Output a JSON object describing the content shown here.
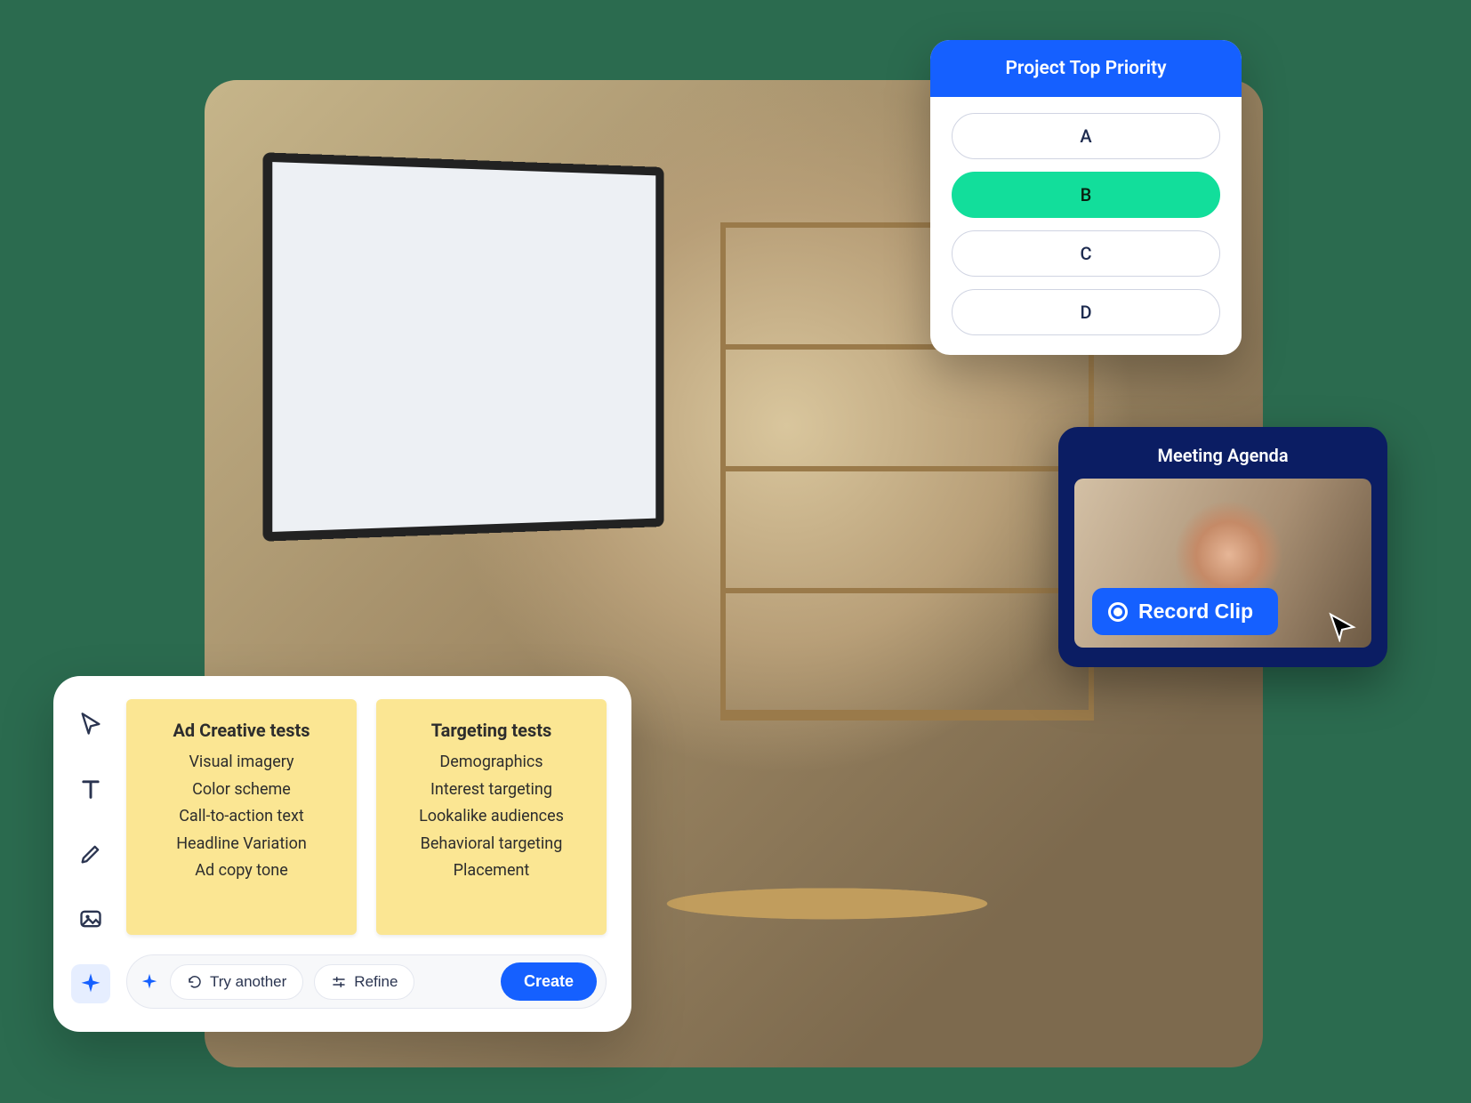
{
  "poll": {
    "title": "Project Top Priority",
    "options": [
      "A",
      "B",
      "C",
      "D"
    ],
    "selected_index": 1
  },
  "agenda": {
    "title": "Meeting Agenda",
    "record_label": "Record Clip"
  },
  "ai_panel": {
    "notes": [
      {
        "title": "Ad Creative tests",
        "items": [
          "Visual imagery",
          "Color scheme",
          "Call-to-action text",
          "Headline Variation",
          "Ad copy tone"
        ]
      },
      {
        "title": "Targeting tests",
        "items": [
          "Demographics",
          "Interest targeting",
          "Lookalike audiences",
          "Behavioral targeting",
          "Placement"
        ]
      }
    ],
    "actions": {
      "try_another": "Try another",
      "refine": "Refine",
      "create": "Create"
    }
  }
}
